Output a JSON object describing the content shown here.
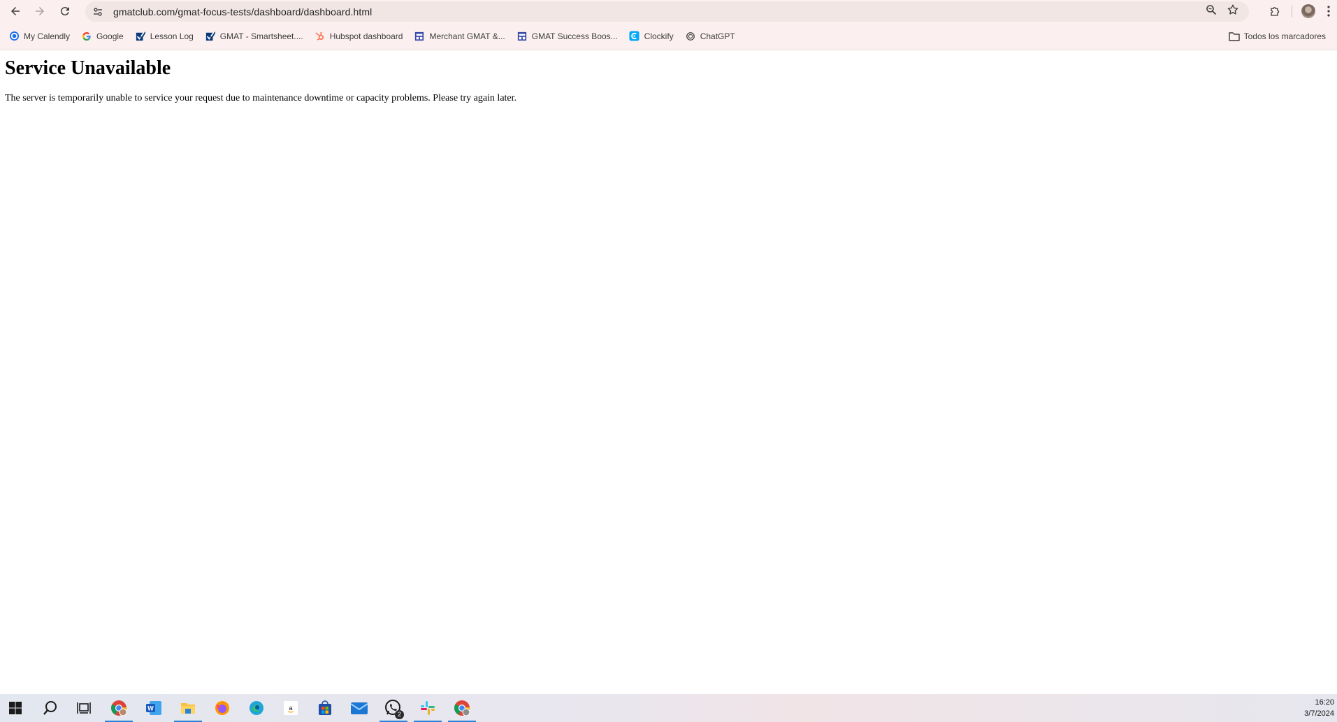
{
  "browser": {
    "url": "gmatclub.com/gmat-focus-tests/dashboard/dashboard.html"
  },
  "bookmarks": [
    {
      "label": "My Calendly",
      "icon": "calendly-icon",
      "color": "#1a6fe8"
    },
    {
      "label": "Google",
      "icon": "google-icon",
      "color": "#4285f4"
    },
    {
      "label": "Lesson Log",
      "icon": "smartsheet-icon",
      "color": "#0b3a7a"
    },
    {
      "label": "GMAT - Smartsheet....",
      "icon": "smartsheet-icon",
      "color": "#0b3a7a"
    },
    {
      "label": "Hubspot dashboard",
      "icon": "hubspot-icon",
      "color": "#ff7a59"
    },
    {
      "label": "Merchant GMAT &...",
      "icon": "form-icon",
      "color": "#3b4aa8"
    },
    {
      "label": "GMAT Success Boos...",
      "icon": "form-icon",
      "color": "#3b4aa8"
    },
    {
      "label": "Clockify",
      "icon": "clockify-icon",
      "color": "#03a9f4"
    },
    {
      "label": "ChatGPT",
      "icon": "chatgpt-icon",
      "color": "#444444"
    }
  ],
  "all_bookmarks_label": "Todos los marcadores",
  "page": {
    "title": "Service Unavailable",
    "message": "The server is temporarily unable to service your request due to maintenance downtime or capacity problems. Please try again later."
  },
  "taskbar": {
    "apps": [
      {
        "name": "chrome-profile-icon",
        "state": "active"
      },
      {
        "name": "word-icon",
        "state": "none"
      },
      {
        "name": "file-explorer-icon",
        "state": "open"
      },
      {
        "name": "firefox-icon",
        "state": "none"
      },
      {
        "name": "edge-icon",
        "state": "none"
      },
      {
        "name": "amazon-icon",
        "state": "none"
      },
      {
        "name": "microsoft-store-icon",
        "state": "none"
      },
      {
        "name": "mail-icon",
        "state": "none"
      },
      {
        "name": "whatsapp-icon",
        "state": "open",
        "badge": "2"
      },
      {
        "name": "slack-icon",
        "state": "open"
      },
      {
        "name": "chrome-icon",
        "state": "open"
      }
    ],
    "time": "16:20",
    "date": "3/7/2024"
  }
}
